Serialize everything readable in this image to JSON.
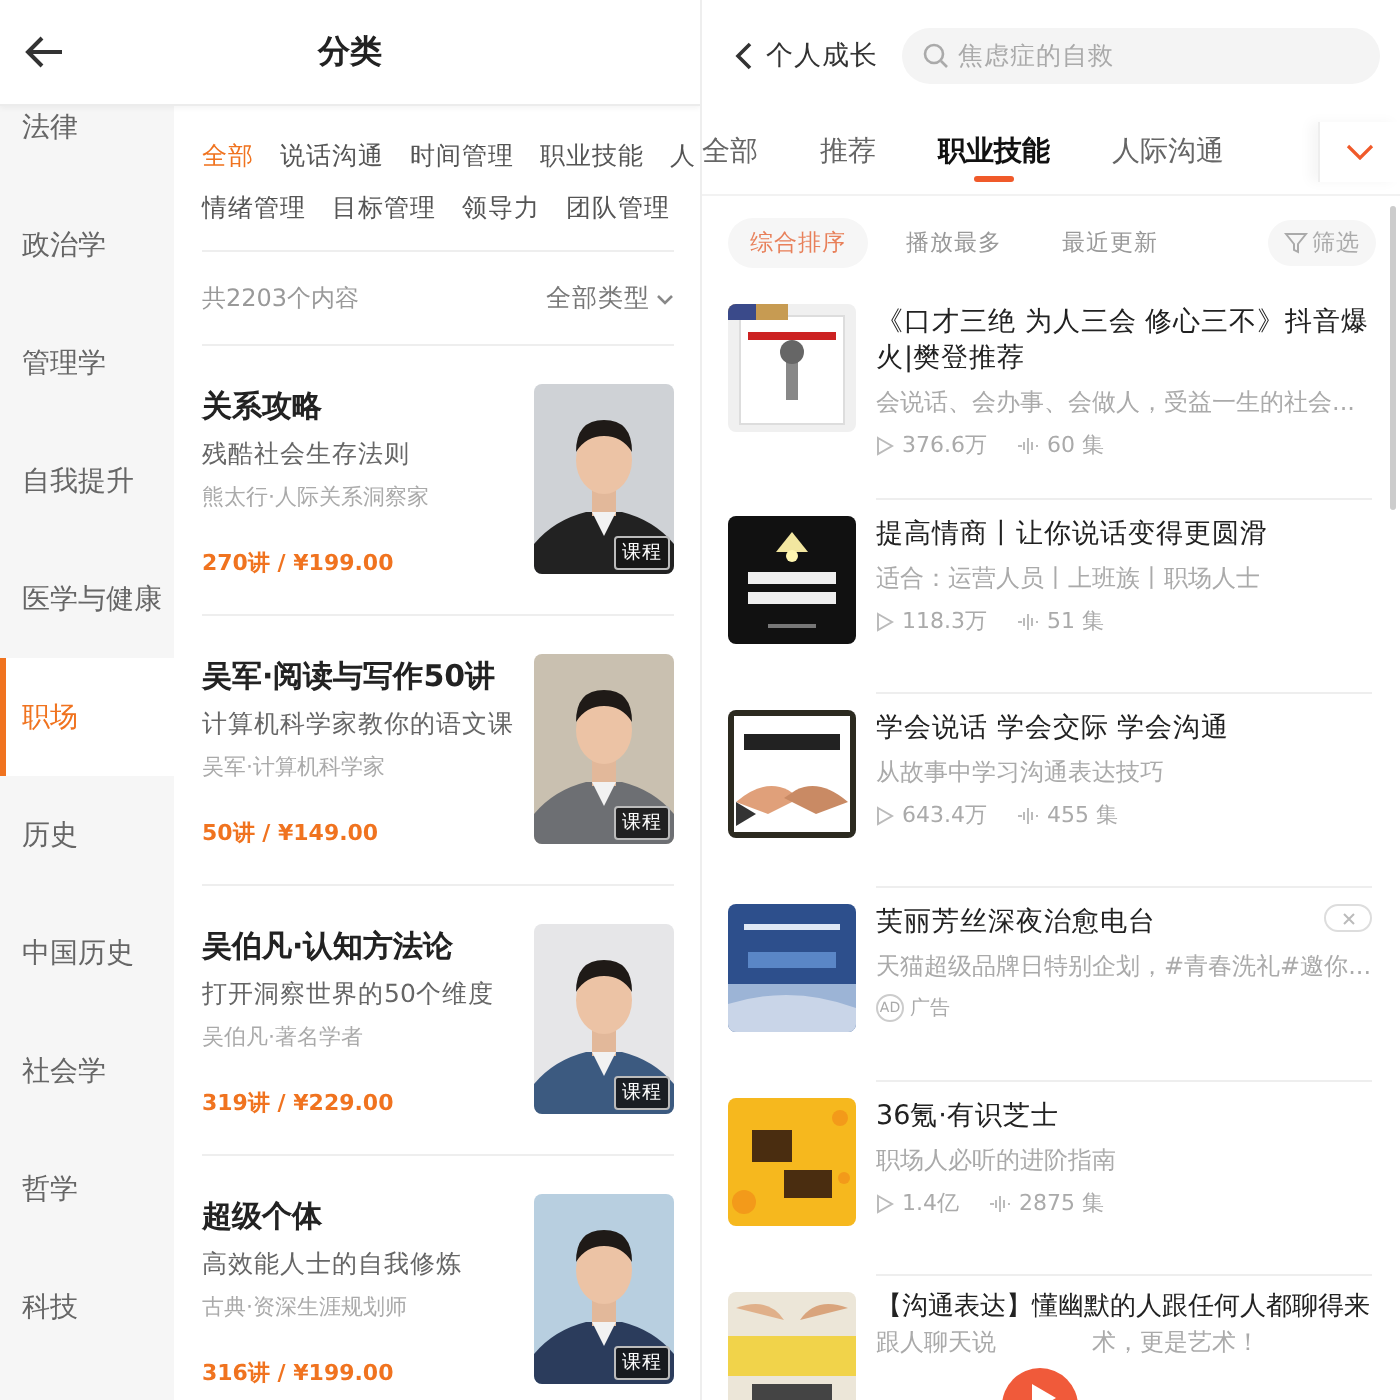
{
  "category_screen": {
    "title": "分类",
    "sidebar": [
      {
        "label": "法律",
        "selected": false
      },
      {
        "label": "政治学",
        "selected": false
      },
      {
        "label": "管理学",
        "selected": false
      },
      {
        "label": "自我提升",
        "selected": false
      },
      {
        "label": "医学与健康",
        "selected": false
      },
      {
        "label": "职场",
        "selected": true
      },
      {
        "label": "历史",
        "selected": false
      },
      {
        "label": "中国历史",
        "selected": false
      },
      {
        "label": "社会学",
        "selected": false
      },
      {
        "label": "哲学",
        "selected": false
      },
      {
        "label": "科技",
        "selected": false
      }
    ],
    "tag_rows": [
      [
        {
          "label": "全部",
          "selected": true
        },
        {
          "label": "说话沟通",
          "selected": false
        },
        {
          "label": "时间管理",
          "selected": false
        },
        {
          "label": "职业技能",
          "selected": false
        },
        {
          "label": "人",
          "selected": false
        }
      ],
      [
        {
          "label": "情绪管理",
          "selected": false
        },
        {
          "label": "目标管理",
          "selected": false
        },
        {
          "label": "领导力",
          "selected": false
        },
        {
          "label": "团队管理",
          "selected": false
        }
      ]
    ],
    "count": "共2203个内容",
    "type_filter": "全部类型",
    "courses": [
      {
        "title": "关系攻略",
        "subtitle": "残酷社会生存法则",
        "author": "熊太行·人际关系洞察家",
        "price": "270讲 / ¥199.00",
        "badge": "课程"
      },
      {
        "title": "吴军·阅读与写作50讲",
        "subtitle": "计算机科学家教你的语文课",
        "author": "吴军·计算机科学家",
        "price": "50讲 / ¥149.00",
        "badge": "课程"
      },
      {
        "title": "吴伯凡·认知方法论",
        "subtitle": "打开洞察世界的50个维度",
        "author": "吴伯凡·著名学者",
        "price": "319讲 / ¥229.00",
        "badge": "课程"
      },
      {
        "title": "超级个体",
        "subtitle": "高效能人士的自我修炼",
        "author": "古典·资深生涯规划师",
        "price": "316讲 / ¥199.00",
        "badge": "课程"
      }
    ]
  },
  "list_screen": {
    "back_label": "个人成长",
    "search": {
      "placeholder": "焦虑症的自救"
    },
    "tabs": [
      {
        "label": "全部",
        "selected": false
      },
      {
        "label": "推荐",
        "selected": false
      },
      {
        "label": "职业技能",
        "selected": true
      },
      {
        "label": "人际沟通",
        "selected": false
      }
    ],
    "sorts": [
      {
        "label": "综合排序",
        "selected": true
      },
      {
        "label": "播放最多",
        "selected": false
      },
      {
        "label": "最近更新",
        "selected": false
      }
    ],
    "filter": "筛选",
    "items": [
      {
        "kind": "album",
        "title": "《口才三绝 为人三会 修心三不》抖音爆火|樊登推荐",
        "description": "会说话、会办事、会做人，受益一生的社会...",
        "plays": "376.6万",
        "episodes": "60 集"
      },
      {
        "kind": "album",
        "title": "提高情商丨让你说话变得更圆滑",
        "description": "适合：运营人员丨上班族丨职场人士",
        "plays": "118.3万",
        "episodes": "51 集"
      },
      {
        "kind": "album",
        "title": "学会说话 学会交际 学会沟通",
        "description": "从故事中学习沟通表达技巧",
        "plays": "643.4万",
        "episodes": "455 集"
      },
      {
        "kind": "ad",
        "title": "芙丽芳丝深夜治愈电台",
        "description": "天猫超级品牌日特别企划，#青春洗礼#邀你...",
        "ad_mark": "AD",
        "ad_label": "广告"
      },
      {
        "kind": "album",
        "title": "36氪·有识芝士",
        "description": "职场人必听的进阶指南",
        "plays": "1.4亿",
        "episodes": "2875 集"
      },
      {
        "kind": "partial",
        "title": "【沟通表达】懂幽默的人跟任何人都聊得来",
        "description_parts": [
          "跟人聊天说",
          "术，更是艺术！"
        ]
      }
    ]
  }
}
